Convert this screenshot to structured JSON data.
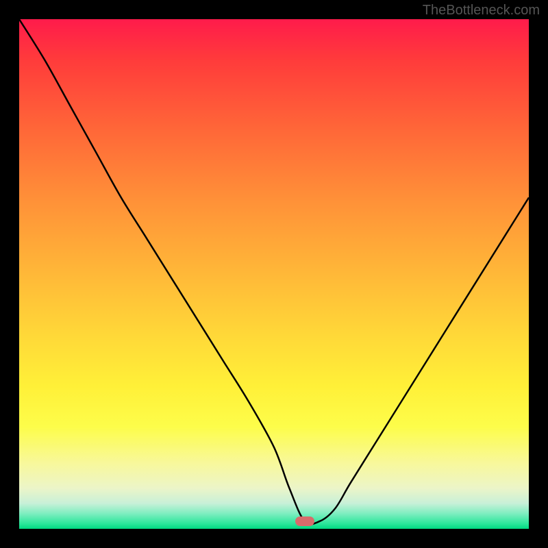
{
  "watermark": "TheBottleneck.com",
  "chart_data": {
    "type": "line",
    "title": "",
    "xlabel": "",
    "ylabel": "",
    "xlim": [
      0,
      100
    ],
    "ylim": [
      0,
      100
    ],
    "grid": false,
    "legend": false,
    "marker": {
      "x": 56,
      "y": 1.5,
      "color": "#d86b6b"
    },
    "gradient_stops": [
      {
        "pos": 0,
        "color": "#ff1b4b"
      },
      {
        "pos": 50,
        "color": "#ffb838"
      },
      {
        "pos": 80,
        "color": "#fdfd4a"
      },
      {
        "pos": 100,
        "color": "#00d880"
      }
    ],
    "series": [
      {
        "name": "curve",
        "color": "#000000",
        "x": [
          0,
          5,
          10,
          15,
          20,
          25,
          30,
          35,
          40,
          45,
          50,
          53,
          56,
          59,
          62,
          65,
          70,
          75,
          80,
          85,
          90,
          95,
          100
        ],
        "y": [
          100,
          92,
          83,
          74,
          65,
          57,
          49,
          41,
          33,
          25,
          16,
          8,
          1.5,
          1.5,
          4,
          9,
          17,
          25,
          33,
          41,
          49,
          57,
          65
        ]
      }
    ]
  }
}
